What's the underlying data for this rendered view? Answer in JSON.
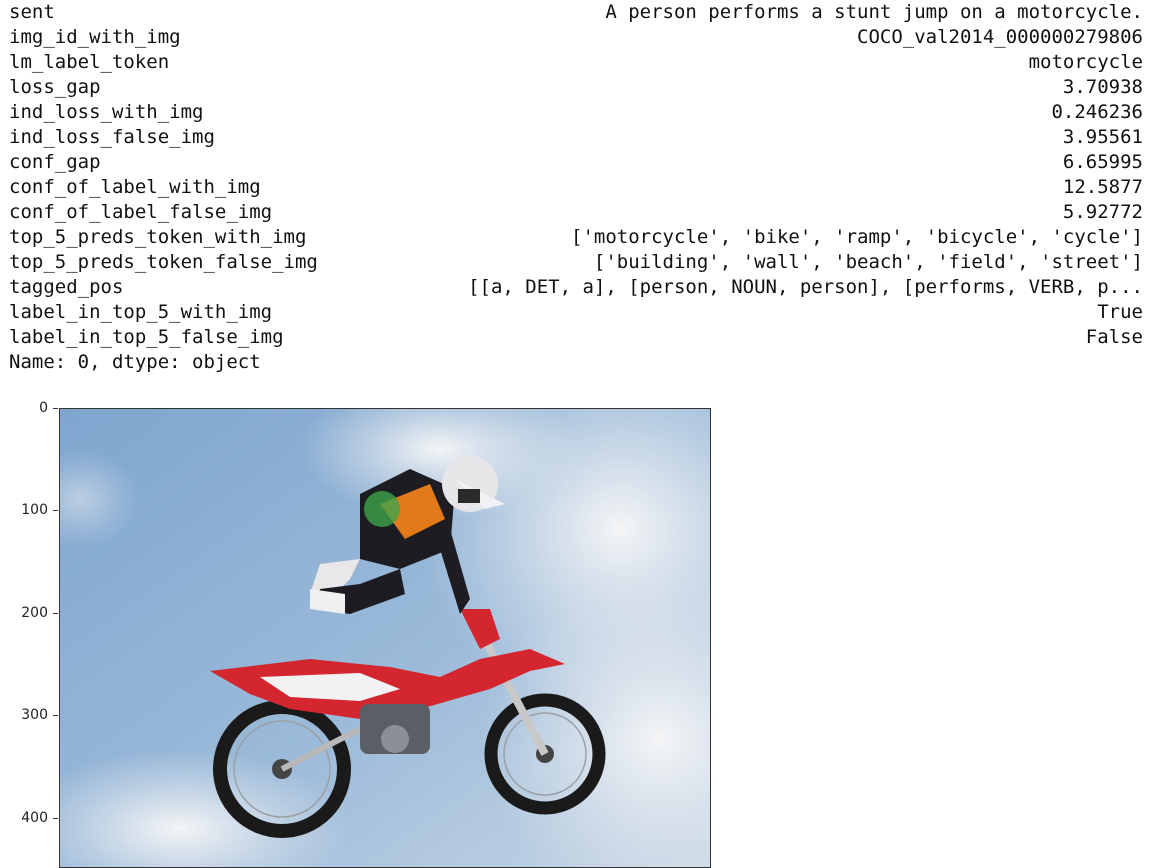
{
  "series_output": {
    "rows": [
      {
        "key": "sent",
        "value": "A person performs a stunt jump on a motorcycle."
      },
      {
        "key": "img_id_with_img",
        "value": "COCO_val2014_000000279806"
      },
      {
        "key": "lm_label_token",
        "value": "motorcycle"
      },
      {
        "key": "loss_gap",
        "value": "3.70938"
      },
      {
        "key": "ind_loss_with_img",
        "value": "0.246236"
      },
      {
        "key": "ind_loss_false_img",
        "value": "3.95561"
      },
      {
        "key": "conf_gap",
        "value": "6.65995"
      },
      {
        "key": "conf_of_label_with_img",
        "value": "12.5877"
      },
      {
        "key": "conf_of_label_false_img",
        "value": "5.92772"
      },
      {
        "key": "top_5_preds_token_with_img",
        "value": "['motorcycle', 'bike', 'ramp', 'bicycle', 'cycle']"
      },
      {
        "key": "top_5_preds_token_false_img",
        "value": "['building', 'wall', 'beach', 'field', 'street']"
      },
      {
        "key": "tagged_pos",
        "value": "[[a, DET, a], [person, NOUN, person], [performs, VERB, p..."
      },
      {
        "key": "label_in_top_5_with_img",
        "value": "True"
      },
      {
        "key": "label_in_top_5_false_img",
        "value": "False"
      }
    ],
    "footer": "Name: 0, dtype: object"
  },
  "plot": {
    "yticks": [
      "0",
      "100",
      "200",
      "300",
      "400"
    ],
    "ylim": [
      0,
      445
    ],
    "image_description": "motocross rider mid-air stunt above red motorcycle against cloudy blue sky",
    "colors": {
      "sky_blue": "#8fb1d3",
      "cloud_white": "#e9edf1",
      "bike_red": "#d3262f",
      "rider_dark": "#1c1c22"
    }
  }
}
